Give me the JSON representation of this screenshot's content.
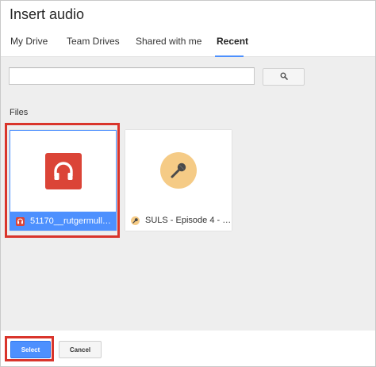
{
  "dialog": {
    "title": "Insert audio"
  },
  "tabs": [
    {
      "label": "My Drive",
      "active": false
    },
    {
      "label": "Team Drives",
      "active": false
    },
    {
      "label": "Shared with me",
      "active": false
    },
    {
      "label": "Recent",
      "active": true
    }
  ],
  "search": {
    "value": "",
    "placeholder": "",
    "button_icon": "search-icon"
  },
  "files": {
    "section_label": "Files",
    "items": [
      {
        "name": "51170__rutgermuller__...",
        "icon": "headphones-icon",
        "selected": true
      },
      {
        "name": "SULS - Episode 4 - 3:9:...",
        "icon": "microphone-icon",
        "selected": false
      }
    ]
  },
  "footer": {
    "select_label": "Select",
    "cancel_label": "Cancel"
  },
  "colors": {
    "accent": "#4d90fe",
    "audio_red": "#db4437",
    "mic_bg": "#f5cb86",
    "highlight": "#d9342b"
  }
}
